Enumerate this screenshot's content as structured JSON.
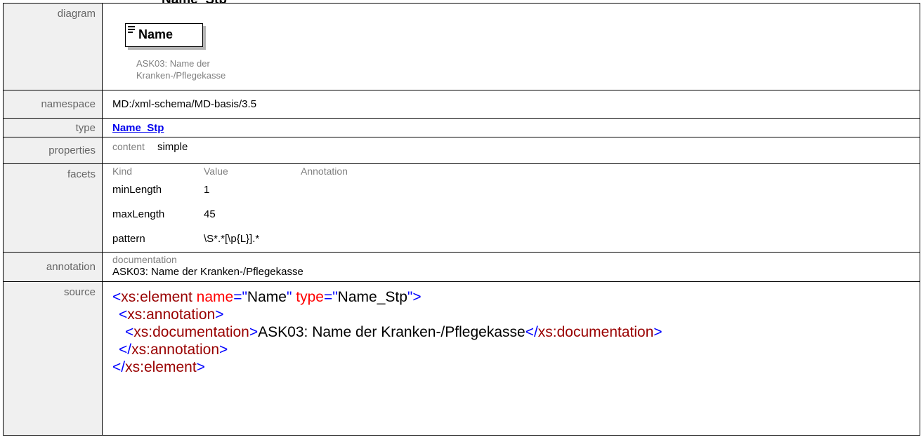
{
  "page_title_clipped": "Name_Stp",
  "labels": {
    "diagram": "diagram",
    "namespace": "namespace",
    "type": "type",
    "properties": "properties",
    "facets": "facets",
    "annotation": "annotation",
    "source": "source"
  },
  "diagram": {
    "element_name": "Name",
    "doc_line1": "ASK03: Name der",
    "doc_line2": "Kranken-/Pflegekasse"
  },
  "namespace": "MD:/xml-schema/MD-basis/3.5",
  "type_link": "Name_Stp",
  "properties": {
    "key": "content",
    "value": "simple"
  },
  "facets": {
    "headers": [
      "Kind",
      "Value",
      "Annotation"
    ],
    "rows": [
      {
        "kind": "minLength",
        "value": "1"
      },
      {
        "kind": "maxLength",
        "value": "45"
      },
      {
        "kind": "pattern",
        "value": "\\S*.*[\\p{L}].*"
      }
    ]
  },
  "annotation": {
    "key": "documentation",
    "value": "ASK03: Name der Kranken-/Pflegekasse"
  },
  "source": {
    "l1_open": "<xs:element",
    "l1_attr1": "name",
    "l1_eq1": "=\"",
    "l1_val1": "Name",
    "l1_q1": "\"",
    "l1_attr2": "type",
    "l1_eq2": "=\"",
    "l1_val2": "Name_Stp",
    "l1_close": "\">",
    "l2": "<xs:annotation>",
    "l3_open": "<xs:documentation>",
    "l3_text": "ASK03: Name der Kranken-/Pflegekasse",
    "l3_close": "</xs:documentation>",
    "l4": "</xs:annotation>",
    "l5": "</xs:element>"
  },
  "colors": {
    "label_bg": "#f0f0f0",
    "label_text": "#666666",
    "link": "#0000ee",
    "xml_tag": "#0000ff",
    "xml_element": "#990000",
    "xml_attr": "#ff0000"
  }
}
